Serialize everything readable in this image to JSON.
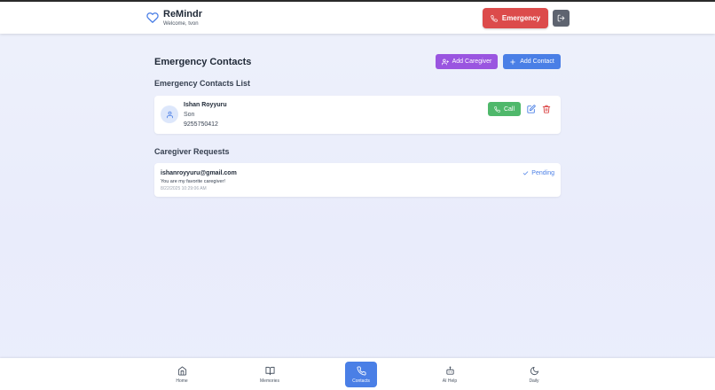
{
  "app": {
    "title": "ReMindr",
    "welcome": "Welcome, tvon"
  },
  "header": {
    "emergency_label": "Emergency",
    "logout_icon": "logout-icon"
  },
  "page": {
    "title": "Emergency Contacts",
    "add_caregiver_label": "Add Caregiver",
    "add_contact_label": "Add Contact"
  },
  "contacts_section": {
    "title": "Emergency Contacts List",
    "contacts": [
      {
        "name": "Ishan Royyuru",
        "relation": "Son",
        "phone": "9255750412",
        "call_label": "Call"
      }
    ]
  },
  "requests_section": {
    "title": "Caregiver Requests",
    "requests": [
      {
        "email": "ishanroyyuru@gmail.com",
        "message": "You are my favorite caregiver!",
        "timestamp": "8/22/2025 10:29:06 AM",
        "status": "Pending"
      }
    ]
  },
  "bottom_nav": {
    "items": [
      {
        "label": "Home",
        "icon": "home-icon"
      },
      {
        "label": "Memories",
        "icon": "book-icon"
      },
      {
        "label": "Contacts",
        "icon": "phone-icon",
        "active": true
      },
      {
        "label": "AI Help",
        "icon": "robot-icon"
      },
      {
        "label": "Daily",
        "icon": "moon-icon"
      }
    ]
  },
  "colors": {
    "emergency": "#dc4b4b",
    "caregiver": "#9a55e0",
    "primary": "#4a7fe6",
    "call": "#4fb86b",
    "delete": "#dc4b4b"
  }
}
